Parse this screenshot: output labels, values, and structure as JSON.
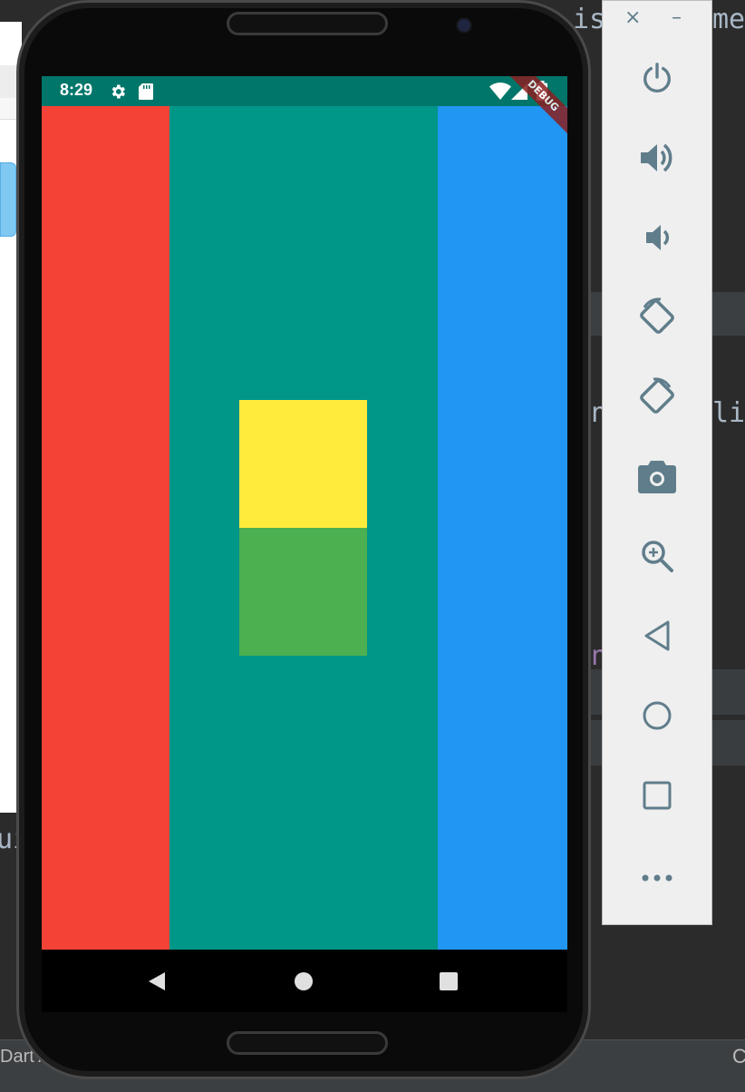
{
  "ide": {
    "code_fragments": [
      "is",
      "me",
      "n",
      "li",
      "ui",
      "n"
    ],
    "status_text": "Dart A",
    "status_right": "C"
  },
  "phone": {
    "status_bar": {
      "time": "8:29",
      "icons": [
        "settings-icon",
        "sd-card-icon",
        "wifi-icon",
        "signal-icon",
        "battery-icon"
      ]
    },
    "debug_banner": "DEBUG",
    "app": {
      "left_column_color": "#f44336",
      "center_column_color": "#009688",
      "right_column_color": "#2196f3",
      "top_box_color": "#ffeb3b",
      "bottom_box_color": "#4caf50"
    },
    "nav_bar": [
      "back-icon",
      "home-icon",
      "recents-icon"
    ]
  },
  "emulator_toolbar": {
    "window_controls": {
      "close": "×",
      "minimize": "–"
    },
    "buttons": [
      "power",
      "volume-up",
      "volume-down",
      "rotate-left",
      "rotate-right",
      "screenshot",
      "zoom",
      "back",
      "home",
      "overview",
      "more"
    ]
  }
}
